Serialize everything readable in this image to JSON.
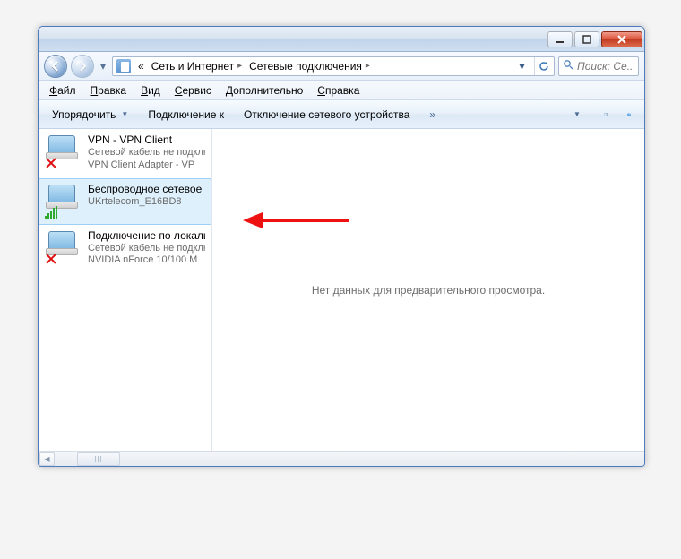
{
  "breadcrumb": {
    "prefix": "«",
    "sep": "▸",
    "item1": "Сеть и Интернет",
    "item2": "Сетевые подключения"
  },
  "search": {
    "placeholder": "Поиск: Се..."
  },
  "menubar": {
    "file": {
      "u": "Ф",
      "rest": "айл"
    },
    "edit": {
      "u": "П",
      "rest": "равка"
    },
    "view": {
      "u": "В",
      "rest": "ид"
    },
    "tools": {
      "u": "С",
      "rest": "ервис"
    },
    "adv": {
      "u": "Д",
      "rest": "ополнительно"
    },
    "help": {
      "u": "С",
      "rest": "правка"
    }
  },
  "toolbar": {
    "organize": "Упорядочить",
    "connect": "Подключение к",
    "disable": "Отключение сетевого устройства",
    "overflow": "»"
  },
  "connections": [
    {
      "title": "VPN - VPN Client",
      "line2": "Сетевой кабель не подключен",
      "line3": "VPN Client Adapter - VP",
      "status": "error",
      "selected": false
    },
    {
      "title": "Беспроводное сетевое соединение",
      "line2": "",
      "line3": "UKrtelecom_E16BD8",
      "status": "signal",
      "selected": true
    },
    {
      "title": "Подключение по локальной сети",
      "line2": "Сетевой кабель не подключен",
      "line3": "NVIDIA nForce 10/100 M",
      "status": "error",
      "selected": false
    }
  ],
  "preview": {
    "empty": "Нет данных для предварительного просмотра."
  }
}
